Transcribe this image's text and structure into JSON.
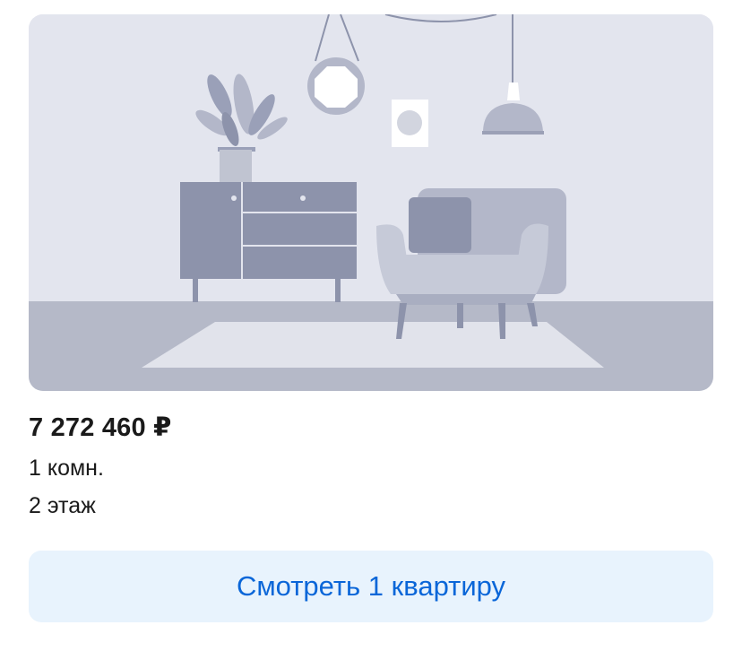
{
  "listing": {
    "image_icon": "apartment-interior-placeholder-illustration",
    "price": "7 272 460 ₽",
    "rooms": "1 комн.",
    "floor": "2 этаж",
    "cta_label": "Смотреть 1 квартиру"
  },
  "colors": {
    "wall": "#e3e5ee",
    "floor": "#b5b9c8",
    "furniture_dark": "#8d93ab",
    "furniture_light": "#b3b7c9",
    "cta_background": "#e8f3fd",
    "cta_text": "#0a66d8"
  }
}
